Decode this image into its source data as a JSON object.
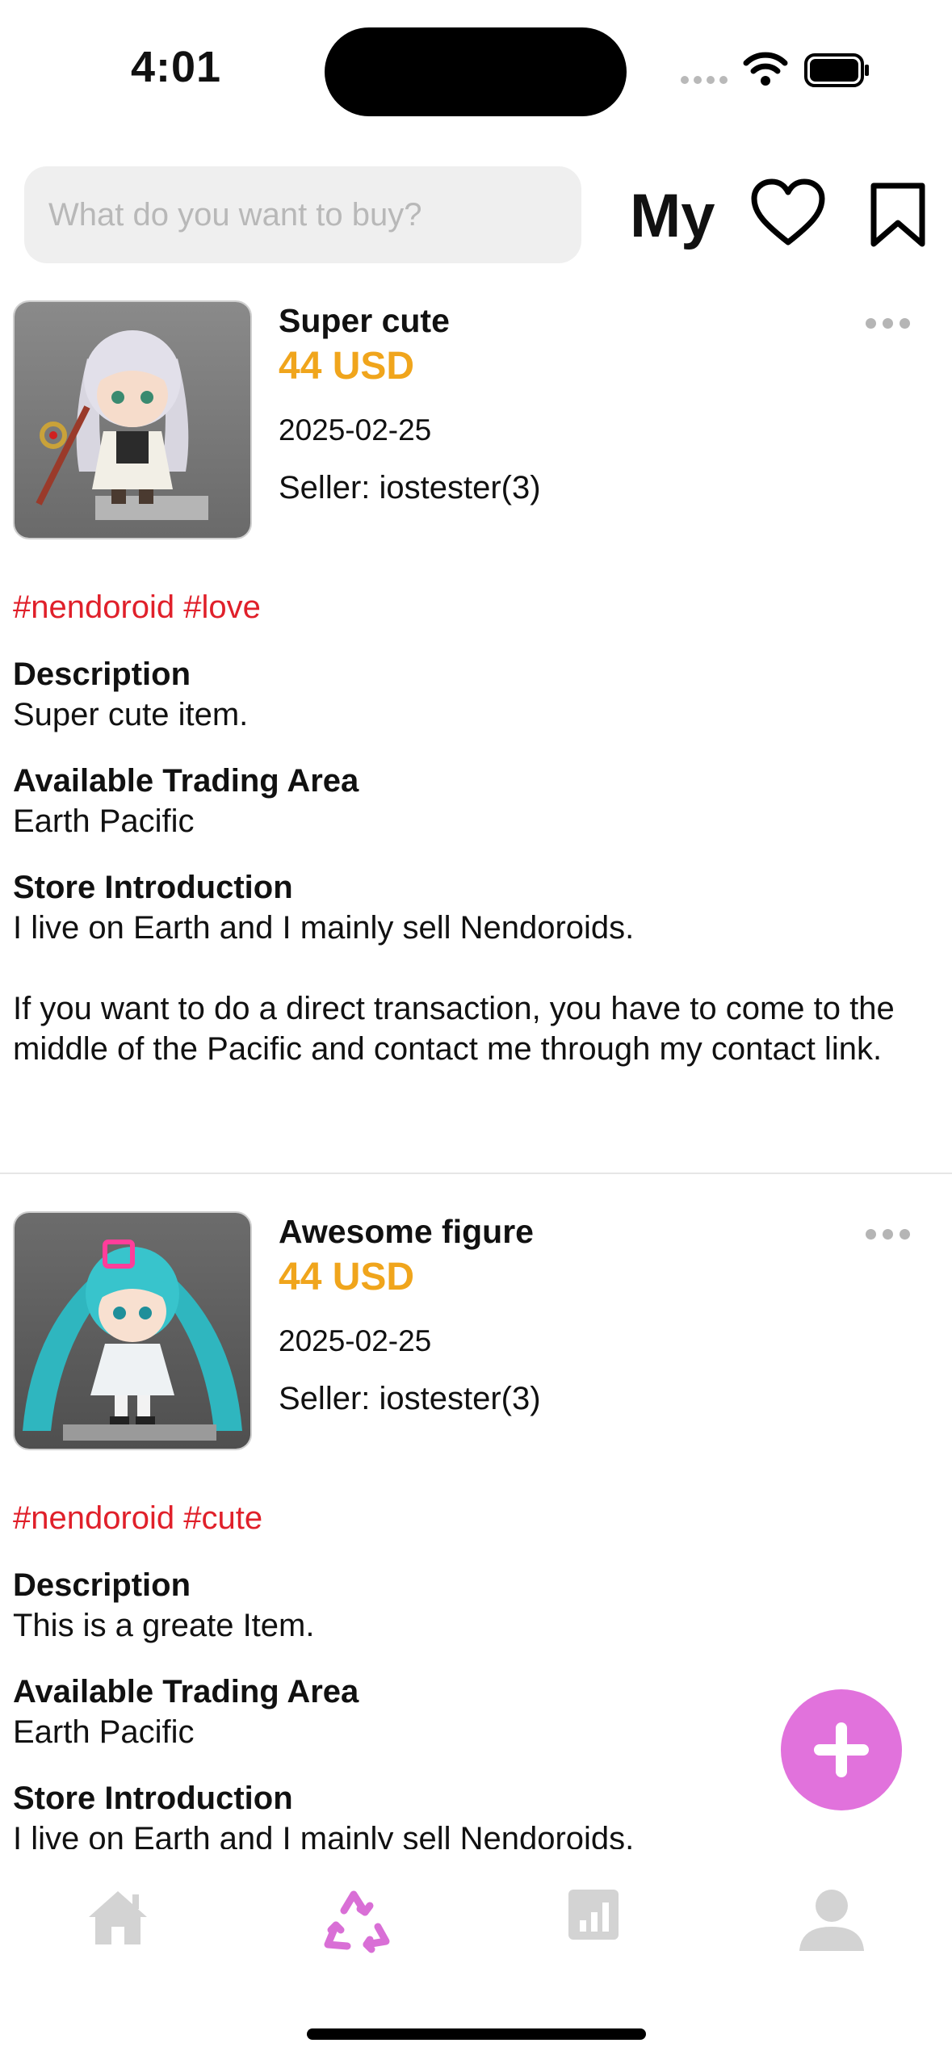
{
  "status_bar": {
    "time": "4:01"
  },
  "search": {
    "placeholder": "What do you want to buy?"
  },
  "header": {
    "my_label": "My"
  },
  "colors": {
    "accent": "#e172dc",
    "price": "#f0a51c",
    "tag": "#e0202a",
    "inactive_tab": "#d3d3d3"
  },
  "items": [
    {
      "title": "Super cute",
      "price": "44 USD",
      "date": "2025-02-25",
      "seller": "Seller: iostester(3)",
      "tags": "#nendoroid #love",
      "description_label": "Description",
      "description": "Super cute item.",
      "area_label": "Available Trading Area",
      "area": "Earth Pacific",
      "store_label": "Store Introduction",
      "store": "I live on Earth and I mainly sell Nendoroids.\n\nIf you want to do a direct transaction, you have to come to the middle of the Pacific and contact me through my contact link."
    },
    {
      "title": "Awesome figure",
      "price": "44 USD",
      "date": "2025-02-25",
      "seller": "Seller: iostester(3)",
      "tags": "#nendoroid #cute",
      "description_label": "Description",
      "description": "This is a greate Item.",
      "area_label": "Available Trading Area",
      "area": "Earth Pacific",
      "store_label": "Store Introduction",
      "store": "I live on Earth and I mainly sell Nendoroids."
    }
  ],
  "tabbar": {
    "tabs": [
      {
        "icon": "home-icon",
        "active": false
      },
      {
        "icon": "recycle-icon",
        "active": true
      },
      {
        "icon": "chart-icon",
        "active": false
      },
      {
        "icon": "profile-icon",
        "active": false
      }
    ]
  }
}
